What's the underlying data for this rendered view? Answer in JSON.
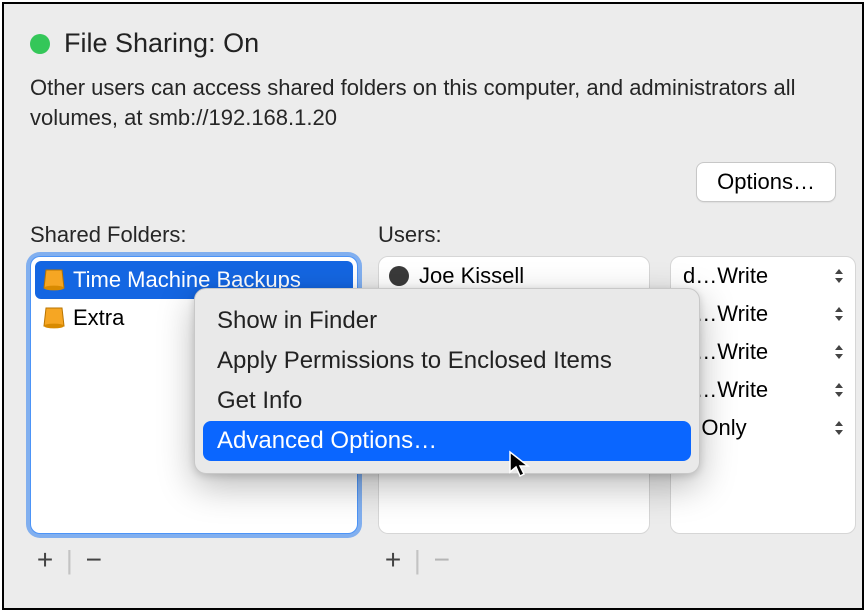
{
  "header": {
    "title": "File Sharing: On",
    "status_color": "#34c759"
  },
  "description": "Other users can access shared folders on this computer, and administrators all volumes, at smb://192.168.1.20",
  "options_button": "Options…",
  "folders": {
    "header": "Shared Folders:",
    "items": [
      {
        "name": "Time Machine Backups",
        "selected": true
      },
      {
        "name": "Extra",
        "selected": false
      }
    ]
  },
  "users": {
    "header": "Users:",
    "items": [
      {
        "name": "Joe Kissell"
      }
    ]
  },
  "permissions": {
    "rows": [
      {
        "label": "d…Write"
      },
      {
        "label": "d…Write"
      },
      {
        "label": "d…Write"
      },
      {
        "label": "d…Write"
      },
      {
        "label": "d Only"
      }
    ]
  },
  "context_menu": {
    "items": [
      {
        "label": "Show in Finder",
        "highlight": false
      },
      {
        "label": "Apply Permissions to Enclosed Items",
        "highlight": false
      },
      {
        "label": "Get Info",
        "highlight": false
      },
      {
        "label": "Advanced Options…",
        "highlight": true
      }
    ]
  },
  "buttons": {
    "plus": "+",
    "minus": "−"
  }
}
